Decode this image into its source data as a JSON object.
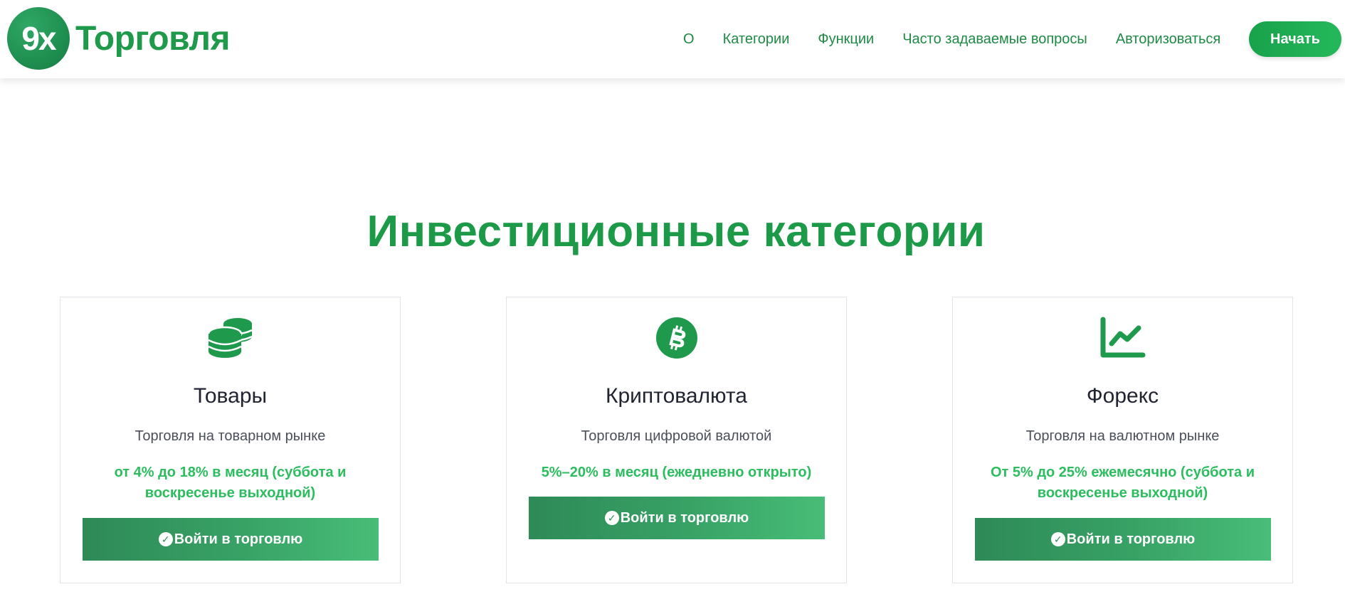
{
  "header": {
    "logo_badge": "9x",
    "logo_text": "Торговля",
    "nav": [
      "О",
      "Категории",
      "Функции",
      "Часто задаваемые вопросы",
      "Авторизоваться"
    ],
    "start_label": "Начать"
  },
  "section": {
    "title": "Инвестиционные категории"
  },
  "cards": [
    {
      "icon": "coins-icon",
      "title": "Товары",
      "desc": "Торговля на товарном рынке",
      "rate": "от 4% до 18% в месяц (суббота и воскресенье выходной)",
      "button": "Войти в торговлю"
    },
    {
      "icon": "bitcoin-icon",
      "title": "Криптовалюта",
      "desc": "Торговля цифровой валютой",
      "rate": "5%–20% в месяц (ежедневно открыто)",
      "button": "Войти в торговлю"
    },
    {
      "icon": "chart-line-icon",
      "title": "Форекс",
      "desc": "Торговля на валютном рынке",
      "rate": "От 5% до 25% ежемесячно (суббота и воскресенье выходной)",
      "button": "Войти в торговлю"
    }
  ],
  "colors": {
    "brand": "#1e9a4a",
    "accent": "#2bbd5e",
    "button_start": "#2e8a57",
    "button_end": "#48bd78"
  }
}
